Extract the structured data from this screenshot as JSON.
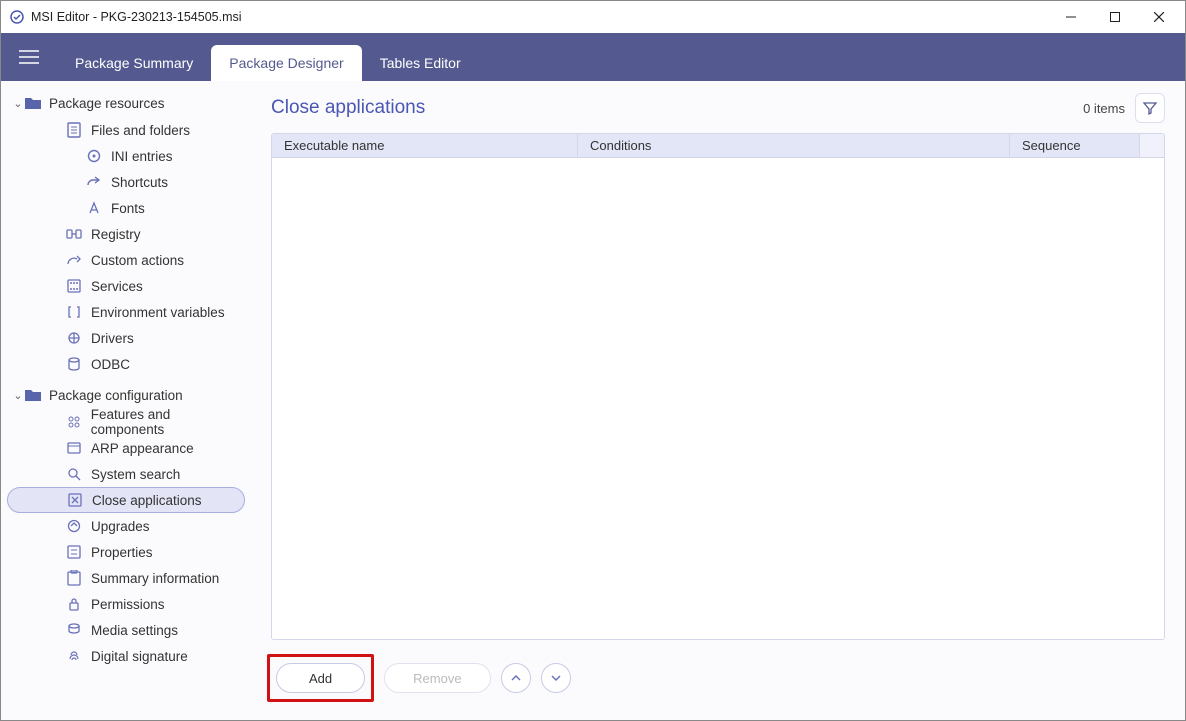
{
  "window": {
    "title": "MSI Editor - PKG-230213-154505.msi"
  },
  "ribbon": {
    "tabs": {
      "summary": "Package Summary",
      "designer": "Package Designer",
      "tables": "Tables Editor"
    }
  },
  "sidebar": {
    "group_resources": "Package resources",
    "group_config": "Package configuration",
    "items": {
      "files": "Files and folders",
      "ini": "INI entries",
      "shortcuts": "Shortcuts",
      "fonts": "Fonts",
      "registry": "Registry",
      "custom_actions": "Custom actions",
      "services": "Services",
      "env_vars": "Environment variables",
      "drivers": "Drivers",
      "odbc": "ODBC",
      "features": "Features and components",
      "arp": "ARP appearance",
      "system_search": "System search",
      "close_apps": "Close applications",
      "upgrades": "Upgrades",
      "properties": "Properties",
      "summary_info": "Summary information",
      "permissions": "Permissions",
      "media": "Media settings",
      "digital_sig": "Digital signature"
    }
  },
  "main": {
    "title": "Close applications",
    "item_count": "0 items",
    "columns": {
      "exec": "Executable name",
      "cond": "Conditions",
      "seq": "Sequence"
    },
    "buttons": {
      "add": "Add",
      "remove": "Remove"
    }
  }
}
